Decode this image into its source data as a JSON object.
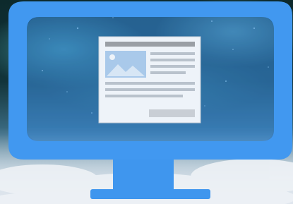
{
  "illustration": {
    "subject": "monitor-icon",
    "screen_content": "webpage-document-icon",
    "colors": {
      "monitor_frame": "#4198f0",
      "monitor_frame_shadow": "#2f7fd8",
      "document_paper": "#eef3f9",
      "document_lines": "#b9c2cc",
      "document_header_bar": "#9a9fa5",
      "image_placeholder": "#a9c9ea",
      "button_placeholder": "#c9ced5"
    }
  }
}
